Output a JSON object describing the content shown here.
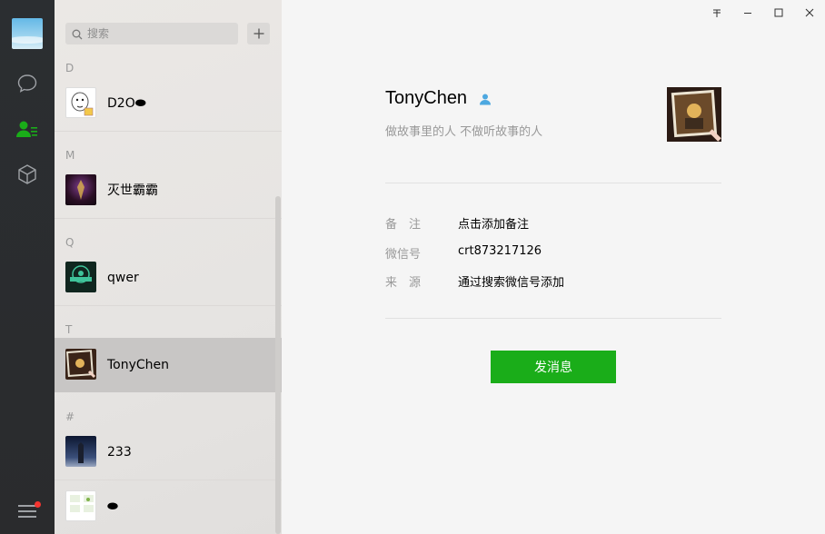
{
  "rail": {
    "icons": [
      "chat-icon",
      "contacts-icon",
      "mini-program-icon",
      "menu-icon"
    ],
    "colors": {
      "active": "#1aad19",
      "inactive": "#9ea1a5",
      "badge": "#f43530"
    }
  },
  "search": {
    "placeholder": "搜索",
    "value": ""
  },
  "contacts": {
    "sections": [
      "D",
      "M",
      "Q",
      "T",
      "#"
    ],
    "items": [
      {
        "name": "D2O⬬",
        "section": "D"
      },
      {
        "name": "灭世霸霸",
        "section": "M"
      },
      {
        "name": "qwer",
        "section": "Q"
      },
      {
        "name": "TonyChen",
        "section": "T",
        "selected": true
      },
      {
        "name": "233",
        "section": "#"
      },
      {
        "name": "⬬",
        "section": "#"
      }
    ]
  },
  "window": {
    "controls": [
      "pin-icon",
      "minimize-icon",
      "maximize-icon",
      "close-icon"
    ]
  },
  "profile": {
    "name": "TonyChen",
    "signature": "做故事里的人 不做听故事的人",
    "fields": [
      {
        "label": "备　注",
        "value": "点击添加备注"
      },
      {
        "label": "微信号",
        "value": "crt873217126"
      },
      {
        "label": "来　源",
        "value": "通过搜索微信号添加"
      }
    ],
    "send_label": "发消息"
  }
}
